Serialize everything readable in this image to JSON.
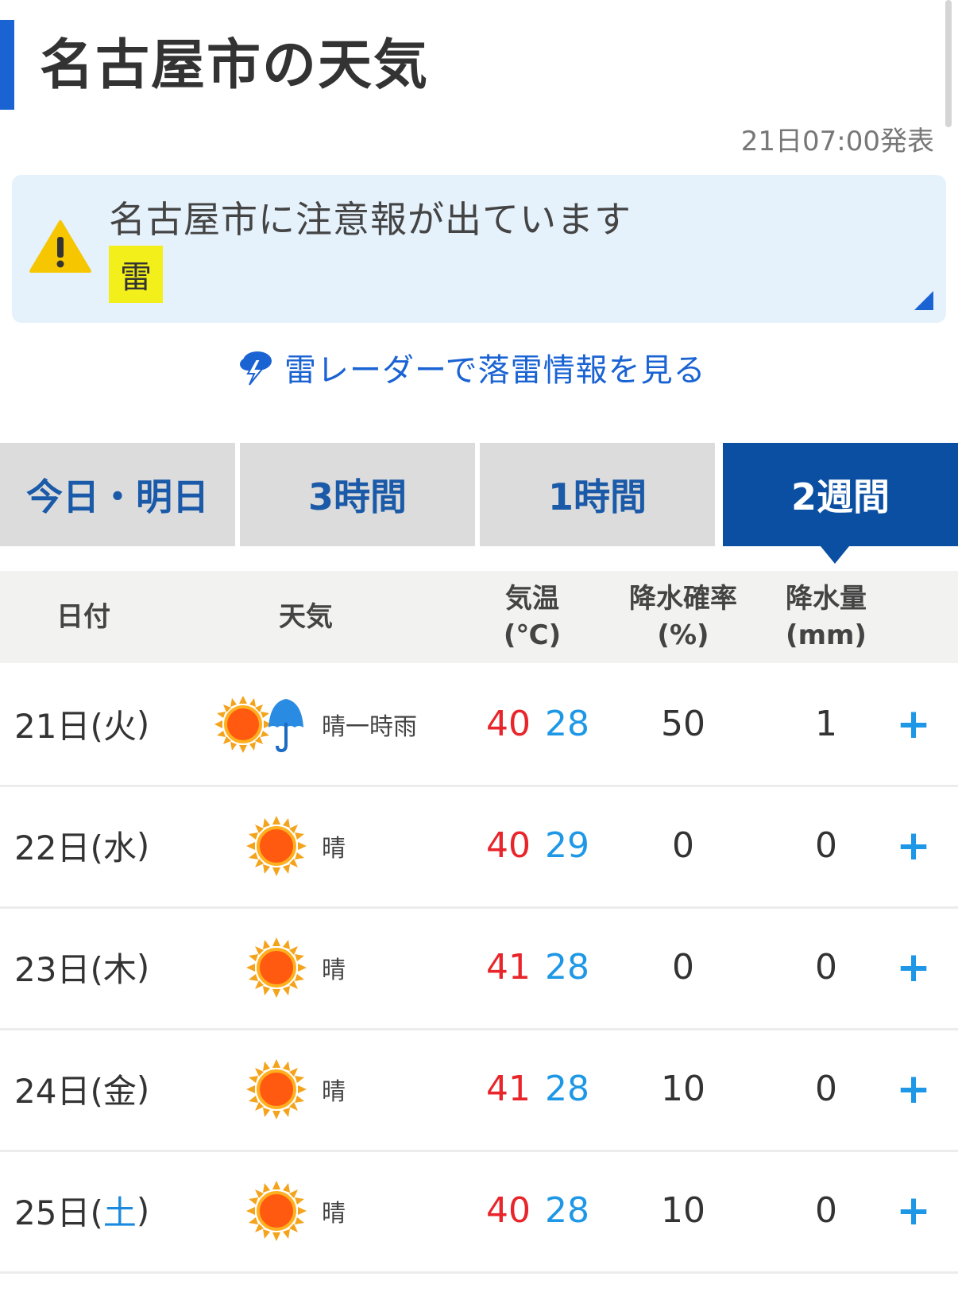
{
  "page": {
    "title": "名古屋市の天気",
    "published": "21日07:00発表"
  },
  "alert": {
    "message": "名古屋市に注意報が出ています",
    "badge": "雷",
    "badge_color": "#f2ef1a",
    "icon": "warning-icon"
  },
  "radar_link": {
    "label": "雷レーダーで落雷情報を見る",
    "icon": "thunder-icon"
  },
  "tabs": [
    {
      "label": "今日・明日",
      "active": false
    },
    {
      "label": "3時間",
      "active": false
    },
    {
      "label": "1時間",
      "active": false
    },
    {
      "label": "2週間",
      "active": true
    }
  ],
  "table": {
    "headers": {
      "date": "日付",
      "weather": "天気",
      "temp_line1": "気温",
      "temp_line2": "(℃)",
      "pop_line1": "降水確率",
      "pop_line2": "(%)",
      "precip_line1": "降水量",
      "precip_line2": "(mm)"
    },
    "rows": [
      {
        "day": "21日(",
        "dow": "火",
        "close": ")",
        "dow_color": "#333333",
        "weather": "晴一時雨",
        "icon": "sun-umbrella-icon",
        "high": "40",
        "low": "28",
        "pop": "50",
        "precip": "1",
        "expand": "+"
      },
      {
        "day": "22日(",
        "dow": "水",
        "close": ")",
        "dow_color": "#333333",
        "weather": "晴",
        "icon": "sun-icon",
        "high": "40",
        "low": "29",
        "pop": "0",
        "precip": "0",
        "expand": "+"
      },
      {
        "day": "23日(",
        "dow": "木",
        "close": ")",
        "dow_color": "#333333",
        "weather": "晴",
        "icon": "sun-icon",
        "high": "41",
        "low": "28",
        "pop": "0",
        "precip": "0",
        "expand": "+"
      },
      {
        "day": "24日(",
        "dow": "金",
        "close": ")",
        "dow_color": "#333333",
        "weather": "晴",
        "icon": "sun-icon",
        "high": "41",
        "low": "28",
        "pop": "10",
        "precip": "0",
        "expand": "+"
      },
      {
        "day": "25日(",
        "dow": "土",
        "close": ")",
        "dow_color": "#1a8ae0",
        "weather": "晴",
        "icon": "sun-icon",
        "high": "40",
        "low": "28",
        "pop": "10",
        "precip": "0",
        "expand": "+"
      }
    ]
  },
  "colors": {
    "accent": "#1a63d3",
    "tab_active": "#0b4fa3",
    "temp_high": "#e8252b",
    "temp_low": "#1e98e6"
  }
}
